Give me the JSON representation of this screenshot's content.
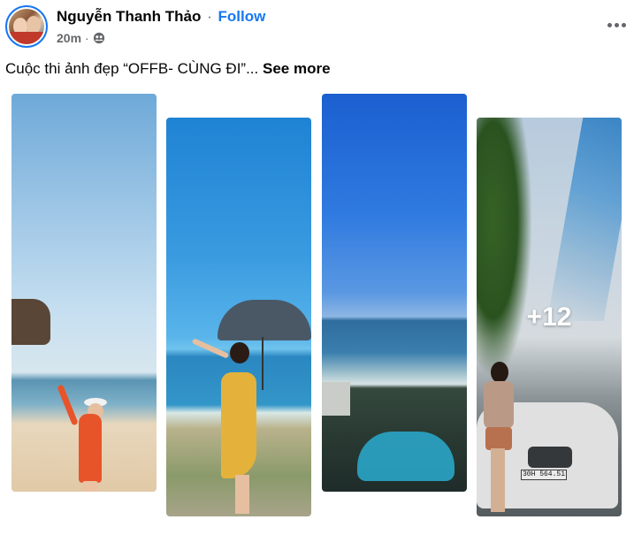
{
  "post": {
    "author": "Nguyễn Thanh Thảo",
    "separator": "·",
    "follow_label": "Follow",
    "time": "20m",
    "time_separator": "·",
    "audience_icon": "friends-icon",
    "more_icon": "more-dots-icon",
    "caption_text": "Cuộc thi ảnh đẹp “OFFB- CÙNG ĐI”...",
    "see_more_label": "See more",
    "remaining_photos_label": "+12",
    "plate_text": "30H 564.51"
  },
  "colors": {
    "accent": "#1877f2",
    "secondary_text": "#65676b",
    "primary_text": "#050505"
  }
}
